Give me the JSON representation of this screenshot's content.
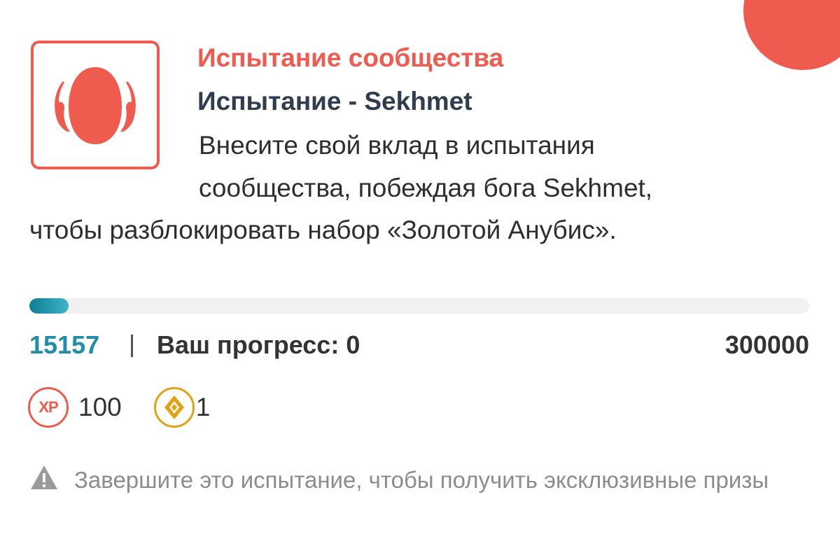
{
  "challenge": {
    "category": "Испытание сообщества",
    "name": "Испытание - Sekhmet",
    "description_lines": [
      "Внесите свой вклад в испытания",
      "сообщества, побеждая бога Sekhmet,",
      "чтобы разблокировать набор «Золотой Анубис»."
    ],
    "emblem_icon": "sekhmet-god-icon",
    "favorite_icon": "star-icon"
  },
  "progress": {
    "current": "15157",
    "your_progress": "Ваш прогресс: 0",
    "goal": "300000",
    "fraction": 0.0505
  },
  "rewards": {
    "xp_label": "XP",
    "xp_value": "100",
    "gem_icon": "gems-icon",
    "gem_value": "1"
  },
  "notice": {
    "icon": "warning-icon",
    "text": "Завершите это испытание, чтобы получить эксклюзивные призы"
  },
  "colors": {
    "accent": "#ef5b4f",
    "heading": "#2f3d4f",
    "progress": "#1f8ea6",
    "gold": "#e3a214",
    "muted": "#8c8c8c"
  }
}
